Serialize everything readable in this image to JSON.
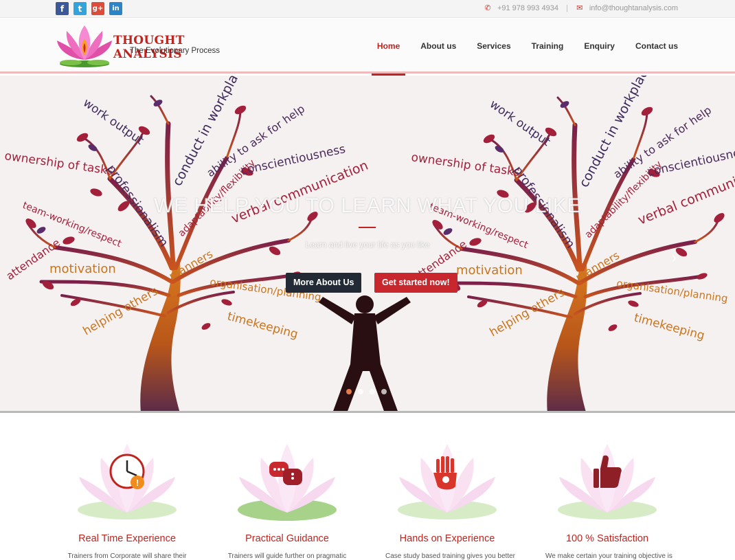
{
  "topbar": {
    "social": [
      {
        "icon": "facebook-icon",
        "glyph": "f",
        "color": "#3b5998"
      },
      {
        "icon": "twitter-icon",
        "glyph": "t",
        "color": "#33a3dc"
      },
      {
        "icon": "google-plus-icon",
        "glyph": "g+",
        "color": "#dd4b39"
      },
      {
        "icon": "linkedin-icon",
        "glyph": "in",
        "color": "#2a84c6"
      }
    ],
    "phone": "+91 978 993 4934",
    "separator": "|",
    "email": "info@thoughtanalysis.com"
  },
  "header": {
    "brand": "THOUGHT ANALYSIS",
    "tagline": "The Evolutionary Process",
    "nav": [
      {
        "label": "Home",
        "active": true
      },
      {
        "label": "About us",
        "active": false
      },
      {
        "label": "Services",
        "active": false
      },
      {
        "label": "Training",
        "active": false
      },
      {
        "label": "Enquiry",
        "active": false
      },
      {
        "label": "Contact us",
        "active": false
      }
    ]
  },
  "hero": {
    "title": "WE HELP YOU TO LEARN WHAT YOU LIKE",
    "subtitle": "Learn and live your life as you like",
    "primary_button": "More About Us",
    "secondary_button": "Get started now!",
    "slide_count": 4,
    "active_slide": 1,
    "tree_words": [
      "work output",
      "conduct in workplace",
      "ability to ask for help",
      "ownership of tasks",
      "professionalism",
      "conscientiousness",
      "team-working/respect",
      "adaptability/flexibility",
      "verbal communication",
      "attendance",
      "motivation",
      "manners",
      "organisation/planning",
      "helping others",
      "timekeeping"
    ]
  },
  "features": [
    {
      "title": "Real Time Experience",
      "text": "Trainers from Corporate will share their",
      "icon": "clock-icon"
    },
    {
      "title": "Practical Guidance",
      "text": "Trainers will guide further on pragmatic",
      "icon": "chat-bubbles-icon"
    },
    {
      "title": "Hands on Experience",
      "text": "Case study based training gives you better",
      "icon": "hand-icon"
    },
    {
      "title": "100 % Satisfaction",
      "text": "We make certain your training objective is",
      "icon": "thumbs-up-icon"
    }
  ],
  "colors": {
    "accent": "#c0241f",
    "dark_button": "#222a35",
    "red_button": "#c8282d"
  }
}
